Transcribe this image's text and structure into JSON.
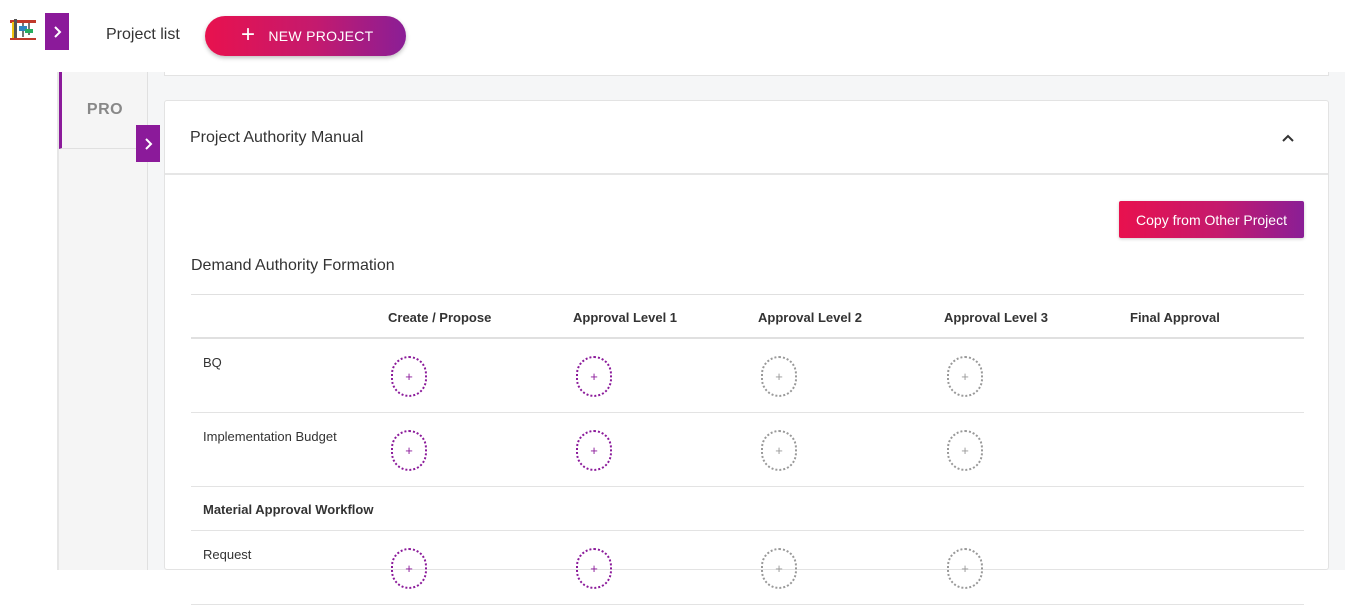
{
  "header": {
    "title": "Project list",
    "new_project_icon": "+",
    "new_project_label": "NEW PROJECT"
  },
  "icons": {
    "logo": "construction-crane-logo",
    "expand": "chevron-right-icon",
    "collapse": "chevron-up-icon",
    "add": "plus-icon"
  },
  "sidebar": {
    "tab_label": "PRO"
  },
  "card": {
    "title": "Project Authority Manual",
    "copy_button": "Copy from Other Project",
    "section_title": "Demand Authority Formation",
    "columns": [
      "",
      "Create / Propose",
      "Approval Level 1",
      "Approval Level 2",
      "Approval Level 3",
      "Final Approval"
    ],
    "rows": [
      {
        "label": "BQ",
        "slots": [
          "active",
          "active",
          "inactive",
          "inactive"
        ]
      },
      {
        "label": "Implementation Budget",
        "slots": [
          "active",
          "active",
          "inactive",
          "inactive"
        ]
      }
    ],
    "group_label": "Material Approval Workflow",
    "group_rows": [
      {
        "label": "Request",
        "slots": [
          "active",
          "active",
          "inactive",
          "inactive"
        ]
      }
    ],
    "slot_symbol": "+"
  },
  "colors": {
    "accent": "#8b1a9a",
    "gradient_start": "#e8114e",
    "gradient_end": "#8a1e96",
    "inactive": "#999999"
  }
}
